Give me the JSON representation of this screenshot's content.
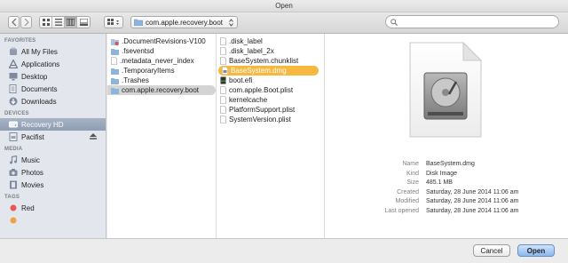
{
  "window": {
    "title": "Open"
  },
  "toolbar": {
    "location": "com.apple.recovery.boot",
    "search_value": "",
    "view_active": "columns"
  },
  "sidebar": {
    "sections": [
      {
        "title": "FAVORITES",
        "items": [
          {
            "label": "All My Files",
            "icon": "all-files-icon"
          },
          {
            "label": "Applications",
            "icon": "applications-icon"
          },
          {
            "label": "Desktop",
            "icon": "desktop-icon"
          },
          {
            "label": "Documents",
            "icon": "documents-icon"
          },
          {
            "label": "Downloads",
            "icon": "downloads-icon"
          }
        ]
      },
      {
        "title": "DEVICES",
        "items": [
          {
            "label": "Recovery HD",
            "icon": "disk-icon",
            "selected": true
          },
          {
            "label": "Pacifist",
            "icon": "disk-image-icon",
            "eject": true
          }
        ]
      },
      {
        "title": "MEDIA",
        "items": [
          {
            "label": "Music",
            "icon": "music-icon"
          },
          {
            "label": "Photos",
            "icon": "camera-icon"
          },
          {
            "label": "Movies",
            "icon": "film-icon"
          }
        ]
      },
      {
        "title": "TAGS",
        "items": [
          {
            "label": "Red",
            "icon": "tag-dot-icon",
            "color": "#e85757"
          }
        ]
      }
    ]
  },
  "columns": {
    "col1": [
      {
        "name": ".DocumentRevisions-V100",
        "kind": "folder",
        "ico": "folder-restricted"
      },
      {
        "name": ".fseventsd",
        "kind": "folder",
        "ico": "folder"
      },
      {
        "name": ".metadata_never_index",
        "kind": "file",
        "ico": "doc"
      },
      {
        "name": ".TemporaryItems",
        "kind": "folder",
        "ico": "folder"
      },
      {
        "name": ".Trashes",
        "kind": "folder",
        "ico": "folder"
      },
      {
        "name": "com.apple.recovery.boot",
        "kind": "folder",
        "ico": "folder",
        "selected": "gray"
      }
    ],
    "col2": [
      {
        "name": ".disk_label",
        "ico": "doc"
      },
      {
        "name": ".disk_label_2x",
        "ico": "doc"
      },
      {
        "name": "BaseSystem.chunklist",
        "ico": "doc"
      },
      {
        "name": "BaseSystem.dmg",
        "ico": "dmg",
        "selected": "orange"
      },
      {
        "name": "boot.efi",
        "ico": "exec"
      },
      {
        "name": "com.apple.Boot.plist",
        "ico": "doc"
      },
      {
        "name": "kernelcache",
        "ico": "doc"
      },
      {
        "name": "PlatformSupport.plist",
        "ico": "doc"
      },
      {
        "name": "SystemVersion.plist",
        "ico": "doc"
      }
    ]
  },
  "preview": {
    "info": [
      {
        "k": "Name",
        "v": "BaseSystem.dmg"
      },
      {
        "k": "Kind",
        "v": "Disk Image"
      },
      {
        "k": "Size",
        "v": "485.1 MB"
      },
      {
        "k": "Created",
        "v": "Saturday, 28 June 2014 11:06 am"
      },
      {
        "k": "Modified",
        "v": "Saturday, 28 June 2014 11:06 am"
      },
      {
        "k": "Last opened",
        "v": "Saturday, 28 June 2014 11:06 am"
      }
    ]
  },
  "buttons": {
    "cancel": "Cancel",
    "open": "Open"
  },
  "colors": {
    "accent_selection": "#f6b83f",
    "sidebar_bg": "#e3e7ed"
  }
}
